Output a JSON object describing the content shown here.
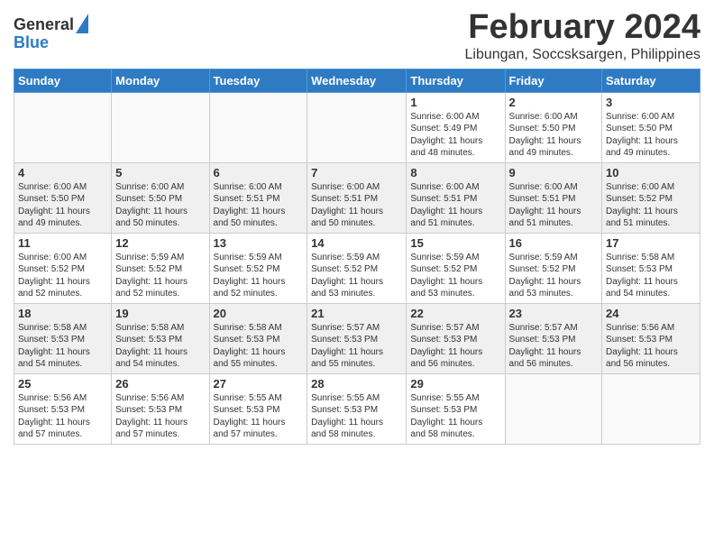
{
  "header": {
    "logo_general": "General",
    "logo_blue": "Blue",
    "month_title": "February 2024",
    "location": "Libungan, Soccsksargen, Philippines"
  },
  "weekdays": [
    "Sunday",
    "Monday",
    "Tuesday",
    "Wednesday",
    "Thursday",
    "Friday",
    "Saturday"
  ],
  "weeks": [
    [
      {
        "day": "",
        "info": ""
      },
      {
        "day": "",
        "info": ""
      },
      {
        "day": "",
        "info": ""
      },
      {
        "day": "",
        "info": ""
      },
      {
        "day": "1",
        "info": "Sunrise: 6:00 AM\nSunset: 5:49 PM\nDaylight: 11 hours\nand 48 minutes."
      },
      {
        "day": "2",
        "info": "Sunrise: 6:00 AM\nSunset: 5:50 PM\nDaylight: 11 hours\nand 49 minutes."
      },
      {
        "day": "3",
        "info": "Sunrise: 6:00 AM\nSunset: 5:50 PM\nDaylight: 11 hours\nand 49 minutes."
      }
    ],
    [
      {
        "day": "4",
        "info": "Sunrise: 6:00 AM\nSunset: 5:50 PM\nDaylight: 11 hours\nand 49 minutes."
      },
      {
        "day": "5",
        "info": "Sunrise: 6:00 AM\nSunset: 5:50 PM\nDaylight: 11 hours\nand 50 minutes."
      },
      {
        "day": "6",
        "info": "Sunrise: 6:00 AM\nSunset: 5:51 PM\nDaylight: 11 hours\nand 50 minutes."
      },
      {
        "day": "7",
        "info": "Sunrise: 6:00 AM\nSunset: 5:51 PM\nDaylight: 11 hours\nand 50 minutes."
      },
      {
        "day": "8",
        "info": "Sunrise: 6:00 AM\nSunset: 5:51 PM\nDaylight: 11 hours\nand 51 minutes."
      },
      {
        "day": "9",
        "info": "Sunrise: 6:00 AM\nSunset: 5:51 PM\nDaylight: 11 hours\nand 51 minutes."
      },
      {
        "day": "10",
        "info": "Sunrise: 6:00 AM\nSunset: 5:52 PM\nDaylight: 11 hours\nand 51 minutes."
      }
    ],
    [
      {
        "day": "11",
        "info": "Sunrise: 6:00 AM\nSunset: 5:52 PM\nDaylight: 11 hours\nand 52 minutes."
      },
      {
        "day": "12",
        "info": "Sunrise: 5:59 AM\nSunset: 5:52 PM\nDaylight: 11 hours\nand 52 minutes."
      },
      {
        "day": "13",
        "info": "Sunrise: 5:59 AM\nSunset: 5:52 PM\nDaylight: 11 hours\nand 52 minutes."
      },
      {
        "day": "14",
        "info": "Sunrise: 5:59 AM\nSunset: 5:52 PM\nDaylight: 11 hours\nand 53 minutes."
      },
      {
        "day": "15",
        "info": "Sunrise: 5:59 AM\nSunset: 5:52 PM\nDaylight: 11 hours\nand 53 minutes."
      },
      {
        "day": "16",
        "info": "Sunrise: 5:59 AM\nSunset: 5:52 PM\nDaylight: 11 hours\nand 53 minutes."
      },
      {
        "day": "17",
        "info": "Sunrise: 5:58 AM\nSunset: 5:53 PM\nDaylight: 11 hours\nand 54 minutes."
      }
    ],
    [
      {
        "day": "18",
        "info": "Sunrise: 5:58 AM\nSunset: 5:53 PM\nDaylight: 11 hours\nand 54 minutes."
      },
      {
        "day": "19",
        "info": "Sunrise: 5:58 AM\nSunset: 5:53 PM\nDaylight: 11 hours\nand 54 minutes."
      },
      {
        "day": "20",
        "info": "Sunrise: 5:58 AM\nSunset: 5:53 PM\nDaylight: 11 hours\nand 55 minutes."
      },
      {
        "day": "21",
        "info": "Sunrise: 5:57 AM\nSunset: 5:53 PM\nDaylight: 11 hours\nand 55 minutes."
      },
      {
        "day": "22",
        "info": "Sunrise: 5:57 AM\nSunset: 5:53 PM\nDaylight: 11 hours\nand 56 minutes."
      },
      {
        "day": "23",
        "info": "Sunrise: 5:57 AM\nSunset: 5:53 PM\nDaylight: 11 hours\nand 56 minutes."
      },
      {
        "day": "24",
        "info": "Sunrise: 5:56 AM\nSunset: 5:53 PM\nDaylight: 11 hours\nand 56 minutes."
      }
    ],
    [
      {
        "day": "25",
        "info": "Sunrise: 5:56 AM\nSunset: 5:53 PM\nDaylight: 11 hours\nand 57 minutes."
      },
      {
        "day": "26",
        "info": "Sunrise: 5:56 AM\nSunset: 5:53 PM\nDaylight: 11 hours\nand 57 minutes."
      },
      {
        "day": "27",
        "info": "Sunrise: 5:55 AM\nSunset: 5:53 PM\nDaylight: 11 hours\nand 57 minutes."
      },
      {
        "day": "28",
        "info": "Sunrise: 5:55 AM\nSunset: 5:53 PM\nDaylight: 11 hours\nand 58 minutes."
      },
      {
        "day": "29",
        "info": "Sunrise: 5:55 AM\nSunset: 5:53 PM\nDaylight: 11 hours\nand 58 minutes."
      },
      {
        "day": "",
        "info": ""
      },
      {
        "day": "",
        "info": ""
      }
    ]
  ]
}
